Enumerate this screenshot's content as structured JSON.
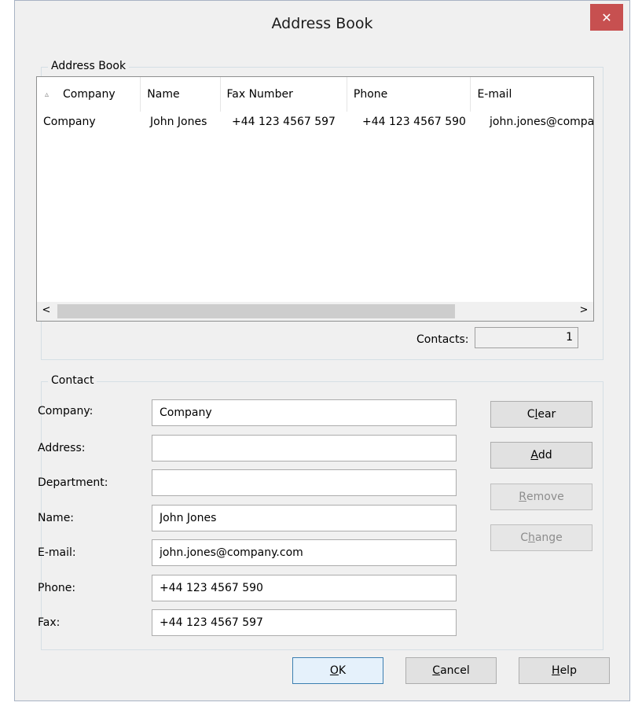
{
  "window": {
    "title": "Address Book",
    "close_glyph": "✕"
  },
  "list_group": {
    "legend": "Address Book",
    "sort_indicator_icon": "sort-up-icon",
    "columns": [
      "Company",
      "Name",
      "Fax Number",
      "Phone",
      "E-mail"
    ],
    "rows": [
      {
        "company": "Company",
        "name": "John Jones",
        "fax": "+44 123 4567 597",
        "phone": "+44 123 4567 590",
        "email": "john.jones@company.com"
      }
    ],
    "contacts_label": "Contacts:",
    "contacts_count": "1"
  },
  "contact_group": {
    "legend": "Contact",
    "company_label": "Company:",
    "company_value": "Company",
    "address_label": "Address:",
    "address_value": "",
    "department_label": "Department:",
    "department_value": "",
    "name_label": "Name:",
    "name_value": "John Jones",
    "email_label": "E-mail:",
    "email_value": "john.jones@company.com",
    "phone_label": "Phone:",
    "phone_value": "+44 123 4567 590",
    "fax_label": "Fax:",
    "fax_value": "+44 123 4567 597"
  },
  "buttons": {
    "clear": {
      "pre": "C",
      "u": "l",
      "post": "ear"
    },
    "add": {
      "pre": "",
      "u": "A",
      "post": "dd"
    },
    "remove": {
      "pre": "",
      "u": "R",
      "post": "emove"
    },
    "change": {
      "pre": "C",
      "u": "h",
      "post": "ange"
    },
    "ok": {
      "pre": "",
      "u": "O",
      "post": "K"
    },
    "cancel": {
      "pre": "",
      "u": "C",
      "post": "ancel"
    },
    "help": {
      "pre": "",
      "u": "H",
      "post": "elp"
    }
  }
}
